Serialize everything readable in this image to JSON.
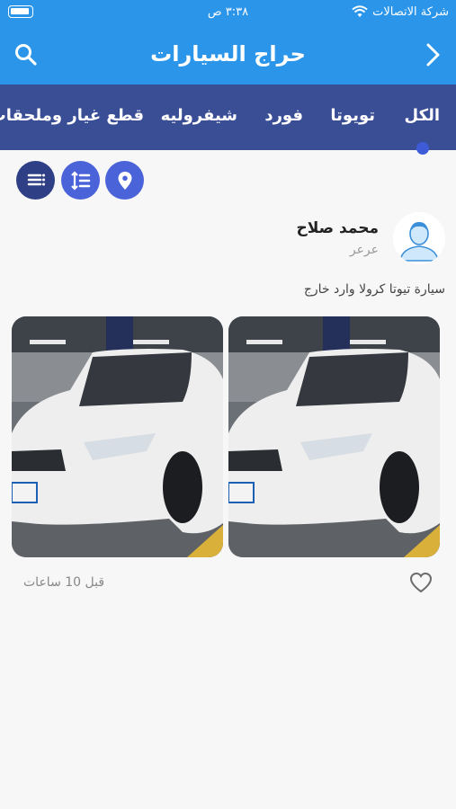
{
  "status_bar": {
    "carrier": "شركة الاتصالات",
    "time": "٣:٣٨ ص"
  },
  "header": {
    "title": "حراج السيارات",
    "back_icon": "chevron-right-icon",
    "search_icon": "search-icon"
  },
  "tabs": [
    {
      "label": "الكل",
      "active": true
    },
    {
      "label": "تويوتا",
      "active": false
    },
    {
      "label": "فورد",
      "active": false
    },
    {
      "label": "شيفروليه",
      "active": false
    },
    {
      "label": "قطع غيار وملحقات",
      "active": false
    }
  ],
  "filters": {
    "buttons": [
      {
        "icon": "list-icon",
        "color": "#2e3f86"
      },
      {
        "icon": "sort-icon",
        "color": "#4b63d8"
      },
      {
        "icon": "location-icon",
        "color": "#4b63d8"
      }
    ]
  },
  "post": {
    "user_name": "محمد صلاح",
    "city": "عرعر",
    "text": "سيارة تيوتا كرولا وارد خارج",
    "image_count": 2,
    "time_ago": "قبل 10 ساعات",
    "like_icon": "heart-outline-icon"
  },
  "colors": {
    "primary": "#2b95ea",
    "tabs_bg": "#3a4e96",
    "accent": "#4b63d8",
    "background": "#f7f7f8"
  }
}
